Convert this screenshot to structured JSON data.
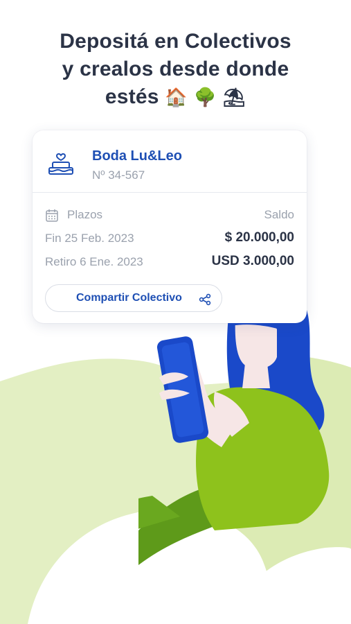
{
  "headline": {
    "line1": "Depositá en Colectivos",
    "line2": "y crealos desde donde",
    "line3_text": "estés",
    "line3_emojis": "🏠 🌳 ⛱"
  },
  "card": {
    "name": "Boda Lu&Leo",
    "number": "Nº 34-567",
    "plazos_label": "Plazos",
    "saldo_label": "Saldo",
    "fin_label": "Fin 25 Feb. 2023",
    "fin_amount": "$ 20.000,00",
    "retiro_label": "Retiro 6 Ene. 2023",
    "retiro_amount": "USD 3.000,00",
    "share_button": "Compartir Colectivo",
    "icons": {
      "cake": "cake-icon",
      "calendar": "calendar-icon",
      "share": "share-icon"
    }
  },
  "colors": {
    "primary_blue": "#1e4fb4",
    "text_dark": "#2b3346",
    "text_grey": "#9aa1ad",
    "green": "#8ec21c",
    "light_green": "#dcebb4",
    "hair_blue": "#1a49c9"
  }
}
